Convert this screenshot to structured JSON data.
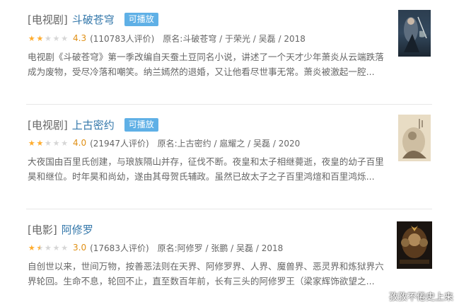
{
  "items": [
    {
      "type_tag": "[电视剧]",
      "title": "斗破苍穹",
      "badge": "可播放",
      "rating": 2.0,
      "score": "4.3",
      "votes": "(110783人评价)",
      "meta": "原名:斗破苍穹 / 于荣光 / 吴磊 / 2018",
      "description": "电视剧《斗破苍穹》第一季改编自天蚕土豆同名小说，讲述了一个天才少年萧炎从云端跌落成为废物，受尽冷落和嘲笑。纳兰嫣然的退婚，又让他看尽世事无常。萧炎被激起一腔..."
    },
    {
      "type_tag": "[电视剧]",
      "title": "上古密约",
      "badge": "可播放",
      "rating": 2.0,
      "score": "4.0",
      "votes": "(21947人评价)",
      "meta": "原名:上古密约 / 扈耀之 / 吴磊 / 2020",
      "description": "大夜国由百里氏创建，与琅族隔山并存，征伐不断。夜皇和太子相继薨逝，夜皇的幼子百里昊和继位。时年昊和尚幼，遂由其母贺氏辅政。虽然已故太子之子百里鸿煊和百里鸿烁..."
    },
    {
      "type_tag": "[电影]",
      "title": "阿修罗",
      "badge": "",
      "rating": 1.5,
      "score": "3.0",
      "votes": "(17683人评价)",
      "meta": "原名:阿修罗 / 张鹏 / 吴磊 / 2018",
      "description": "自创世以来，世间万物，按善恶法则在天界、阿修罗界、人界、魔兽界、恶灵界和炼狱界六界轮回。生命不息，轮回不止，直至数百年前，长有三头的阿修罗王（梁家辉饰欲望之..."
    }
  ],
  "watermark": "孜孜不倦史上来",
  "colors": {
    "title_link": "#3377aa",
    "badge_bg": "#5fb0e6",
    "star_full": "#ffac2d",
    "star_empty": "#d6d6d6",
    "score": "#e09015"
  },
  "icons": {
    "star": "star-icon",
    "poster_1": "poster-doupo-cangqiong",
    "poster_2": "poster-shanggu-miyue",
    "poster_3": "poster-axiuluo"
  }
}
